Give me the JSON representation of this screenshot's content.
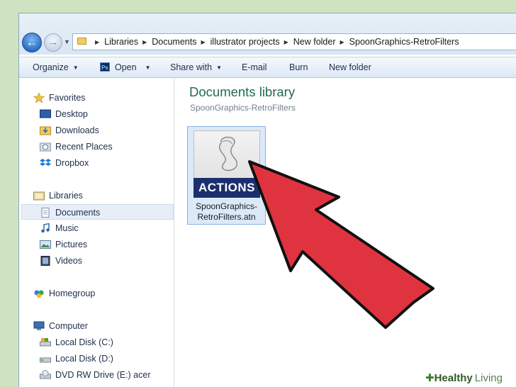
{
  "address_bar": {
    "crumbs": [
      "Libraries",
      "Documents",
      "illustrator projects",
      "New folder",
      "SpoonGraphics-RetroFilters"
    ]
  },
  "toolbar": {
    "organize": "Organize",
    "open": "Open",
    "share_with": "Share with",
    "email": "E-mail",
    "burn": "Burn",
    "new_folder": "New folder"
  },
  "nav": {
    "favorites": "Favorites",
    "desktop": "Desktop",
    "downloads": "Downloads",
    "recent_places": "Recent Places",
    "dropbox": "Dropbox",
    "libraries": "Libraries",
    "documents": "Documents",
    "music": "Music",
    "pictures": "Pictures",
    "videos": "Videos",
    "homegroup": "Homegroup",
    "computer": "Computer",
    "local_c": "Local Disk (C:)",
    "local_d": "Local Disk (D:)",
    "dvd": "DVD RW Drive (E:) acer"
  },
  "content": {
    "title": "Documents library",
    "subtitle": "SpoonGraphics-RetroFilters",
    "file": {
      "badge": "ACTIONS",
      "name_line1": "SpoonGraphics-",
      "name_line2": "RetroFilters.atn"
    }
  },
  "watermark": {
    "brand_bold": "Healthy",
    "brand_light": "Living"
  },
  "colors": {
    "arrow": "#e03340",
    "library_title": "#1f6b53",
    "action_badge": "#1b2f6e"
  }
}
